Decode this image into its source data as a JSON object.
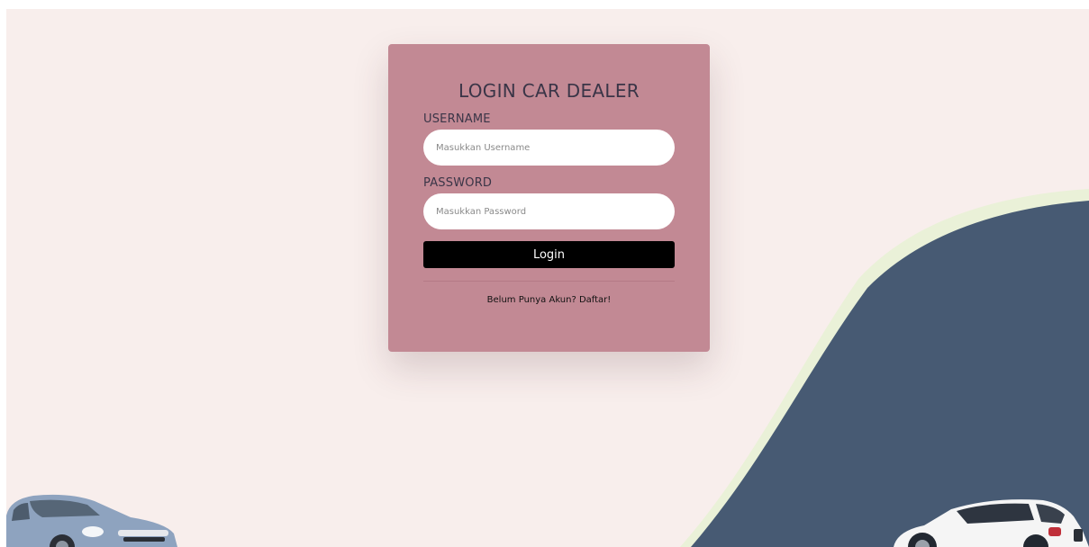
{
  "login": {
    "title": "LOGIN CAR DEALER",
    "username_label": "USERNAME",
    "username_placeholder": "Masukkan Username",
    "username_value": "",
    "password_label": "PASSWORD",
    "password_placeholder": "Masukkan Password",
    "password_value": "",
    "submit_label": "Login",
    "register_link": "Belum Punya Akun? Daftar!"
  },
  "colors": {
    "page_background": "#f8eeec",
    "card_background": "#c28994",
    "wave_fill": "#475a73",
    "wave_outline": "#eaf1d8",
    "button": "#000000"
  }
}
